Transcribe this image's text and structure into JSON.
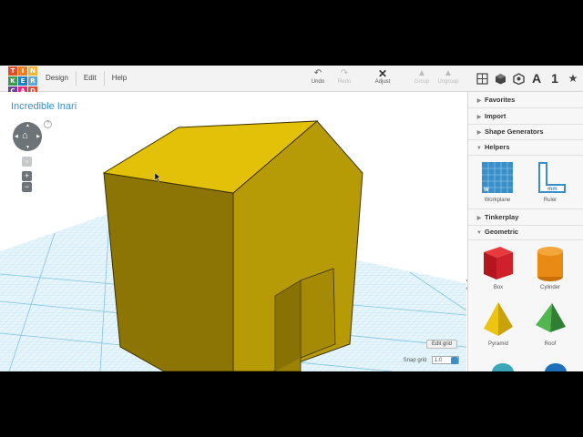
{
  "logo": {
    "letters": [
      "T",
      "I",
      "N",
      "K",
      "E",
      "R",
      "C",
      "A",
      "D"
    ],
    "colors": [
      "#e34c26",
      "#ef7d22",
      "#f1b434",
      "#3a9b48",
      "#1f7fc0",
      "#5fa7d9",
      "#6b3fa0",
      "#e5297d",
      "#e54a2a"
    ]
  },
  "menu": {
    "design": "Design",
    "edit": "Edit",
    "help": "Help"
  },
  "toolbar": {
    "undo": "Undo",
    "redo": "Redo",
    "adjust": "Adjust",
    "group": "Group",
    "ungroup": "Ungroup"
  },
  "view_buttons": {
    "text_label": "A",
    "number_label": "1"
  },
  "design_title": "Incredible Inari",
  "canvas": {
    "edit_grid": "Edit grid",
    "snap_grid_label": "Snap grid",
    "snap_grid_value": "1.0"
  },
  "panel": {
    "sections": {
      "favorites": "Favorites",
      "import": "Import",
      "shape_generators": "Shape Generators",
      "helpers": "Helpers",
      "tinkerplay": "Tinkerplay",
      "geometric": "Geometric"
    },
    "helpers": {
      "workplane": "Workplane",
      "ruler": "Ruler"
    },
    "geometric": {
      "box": "Box",
      "cylinder": "Cylinder",
      "pyramid": "Pyramid",
      "roof": "Roof"
    }
  },
  "colors": {
    "accent": "#3a8fc8",
    "shape_yellow": "#e3c109",
    "box_red": "#d0202c",
    "cylinder_orange": "#e98a14",
    "pyramid_yellow": "#eec412",
    "roof_green": "#3c9c3e"
  }
}
